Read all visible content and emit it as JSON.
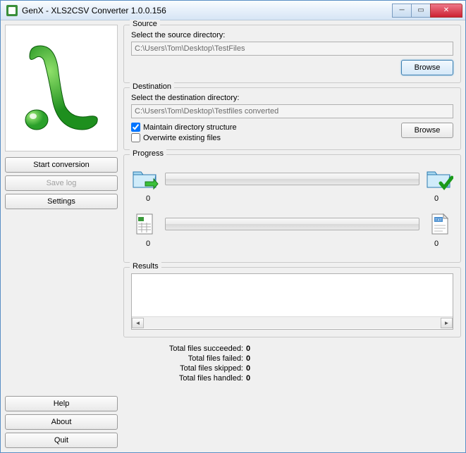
{
  "window": {
    "title": "GenX - XLS2CSV Converter 1.0.0.156"
  },
  "left": {
    "start": "Start conversion",
    "savelog": "Save log",
    "settings": "Settings",
    "help": "Help",
    "about": "About",
    "quit": "Quit"
  },
  "source": {
    "group": "Source",
    "label": "Select the source directory:",
    "path": "C:\\Users\\Tom\\Desktop\\TestFiles",
    "browse": "Browse"
  },
  "dest": {
    "group": "Destination",
    "label": "Select the destination directory:",
    "path": "C:\\Users\\Tom\\Desktop\\Testfiles converted",
    "maintain": "Maintain directory structure",
    "overwrite": "Overwirte existing files",
    "browse": "Browse"
  },
  "progress": {
    "group": "Progress",
    "in_count": "0",
    "out_count": "0",
    "xls_count": "0",
    "txt_count": "0"
  },
  "results": {
    "group": "Results"
  },
  "totals": {
    "succeeded_label": "Total files succeeded:",
    "succeeded_val": "0",
    "failed_label": "Total files failed:",
    "failed_val": "0",
    "skipped_label": "Total files skipped:",
    "skipped_val": "0",
    "handled_label": "Total files handled:",
    "handled_val": "0"
  }
}
